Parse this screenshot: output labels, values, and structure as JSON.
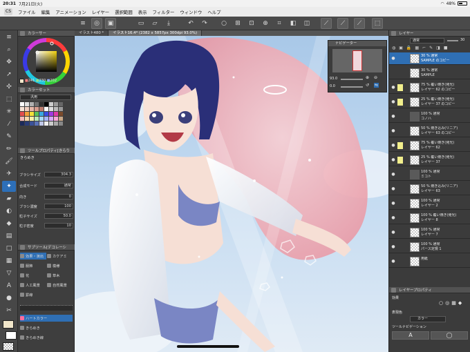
{
  "status_bar": {
    "time": "20:31",
    "date": "7月21日(火)",
    "battery": "48%"
  },
  "menu": {
    "app_label": "CS",
    "items": [
      "ファイル",
      "編集",
      "アニメーション",
      "レイヤー",
      "選択範囲",
      "表示",
      "フィルター",
      "ウィンドウ",
      "ヘルプ"
    ]
  },
  "doc_tabs": [
    {
      "label": "イラスト480 *"
    },
    {
      "label": "イラスト16.4* (2382 x 5857px 300dpi 93.0%)"
    }
  ],
  "color_panel": {
    "title": "カラーサー",
    "rgb": {
      "r": "241",
      "g": "230",
      "b": "202"
    }
  },
  "color_set": {
    "title": "カラーセット",
    "set_name": "汎用"
  },
  "tool_property": {
    "title": "ツールプロパティ[きらり",
    "tool_name": "きらめき",
    "rows": [
      {
        "label": "ブラシサイズ",
        "value": "304.3"
      },
      {
        "label": "合成モード",
        "value": "通常"
      },
      {
        "label": "向き",
        "value": "0"
      },
      {
        "label": "ブラシ濃度",
        "value": "100"
      },
      {
        "label": "粒子サイズ",
        "value": "50.0"
      },
      {
        "label": "粒子密度",
        "value": "10"
      }
    ]
  },
  "sub_tool": {
    "title": "サブツール[デコレーシ",
    "groups": [
      "効果・演出",
      "カケアミ",
      "服飾",
      "模様",
      "花",
      "草木",
      "人工風景",
      "自然風景",
      "罫線"
    ],
    "items": [
      "ハートカラー",
      "きらめき",
      "きらめき線"
    ]
  },
  "navigator": {
    "title": "ナビゲーター",
    "zoom": "93.0",
    "angle": "0.0"
  },
  "layer_panel": {
    "title": "レイヤー",
    "blend_mode": "通常",
    "opacity": "30",
    "layers": [
      {
        "line1": "30 % 通常",
        "line2": "SAMPLE のコピー",
        "lock": false,
        "eye": true,
        "folder": false,
        "selected": true
      },
      {
        "line1": "30 % 通常",
        "line2": "SAMPLE",
        "lock": false,
        "eye": false,
        "folder": false,
        "selected": false
      },
      {
        "line1": "75 % 覆い焼き(発光)",
        "line2": "レイヤー 62 のコピー",
        "lock": true,
        "eye": true,
        "folder": false,
        "selected": false
      },
      {
        "line1": "25 % 覆い焼き(発光)",
        "line2": "レイヤー 37 のコピー",
        "lock": true,
        "eye": true,
        "folder": false,
        "selected": false
      },
      {
        "line1": "100 % 通常",
        "line2": "コノハ",
        "lock": false,
        "eye": true,
        "folder": true,
        "selected": false
      },
      {
        "line1": "50 % 焼き込み(リニア)",
        "line2": "レイヤー 63 のコピー",
        "lock": false,
        "eye": true,
        "folder": false,
        "selected": false
      },
      {
        "line1": "75 % 覆い焼き(発光)",
        "line2": "レイヤー 62",
        "lock": true,
        "eye": true,
        "folder": false,
        "selected": false
      },
      {
        "line1": "25 % 覆い焼き(発光)",
        "line2": "レイヤー 37",
        "lock": true,
        "eye": true,
        "folder": false,
        "selected": false
      },
      {
        "line1": "100 % 通常",
        "line2": "ミコト",
        "lock": false,
        "eye": true,
        "folder": true,
        "selected": false
      },
      {
        "line1": "50 % 焼き込み(リニア)",
        "line2": "レイヤー 63",
        "lock": false,
        "eye": true,
        "folder": false,
        "selected": false
      },
      {
        "line1": "100 % 通常",
        "line2": "レイヤー 2",
        "lock": false,
        "eye": true,
        "folder": false,
        "selected": false
      },
      {
        "line1": "100 % 覆い焼き(発光)",
        "line2": "レイヤー 8",
        "lock": false,
        "eye": true,
        "folder": false,
        "selected": false
      },
      {
        "line1": "100 % 通常",
        "line2": "レイヤー 7",
        "lock": false,
        "eye": true,
        "folder": false,
        "selected": false
      },
      {
        "line1": "100 % 通常",
        "line2": "パース定規 1",
        "lock": false,
        "eye": true,
        "folder": false,
        "selected": false
      },
      {
        "line1": "",
        "line2": "用紙",
        "lock": false,
        "eye": true,
        "folder": false,
        "selected": false
      }
    ]
  },
  "layer_property": {
    "title": "レイヤープロパティ",
    "effect_label": "効果",
    "color_label": "表現色",
    "color_value": "カラー",
    "tool_nav_label": "ツールナビゲーション"
  },
  "colors": {
    "accent": "#2f6fb4",
    "lock_yellow": "#f2ef8c",
    "main_color": "#f1e6ca"
  }
}
